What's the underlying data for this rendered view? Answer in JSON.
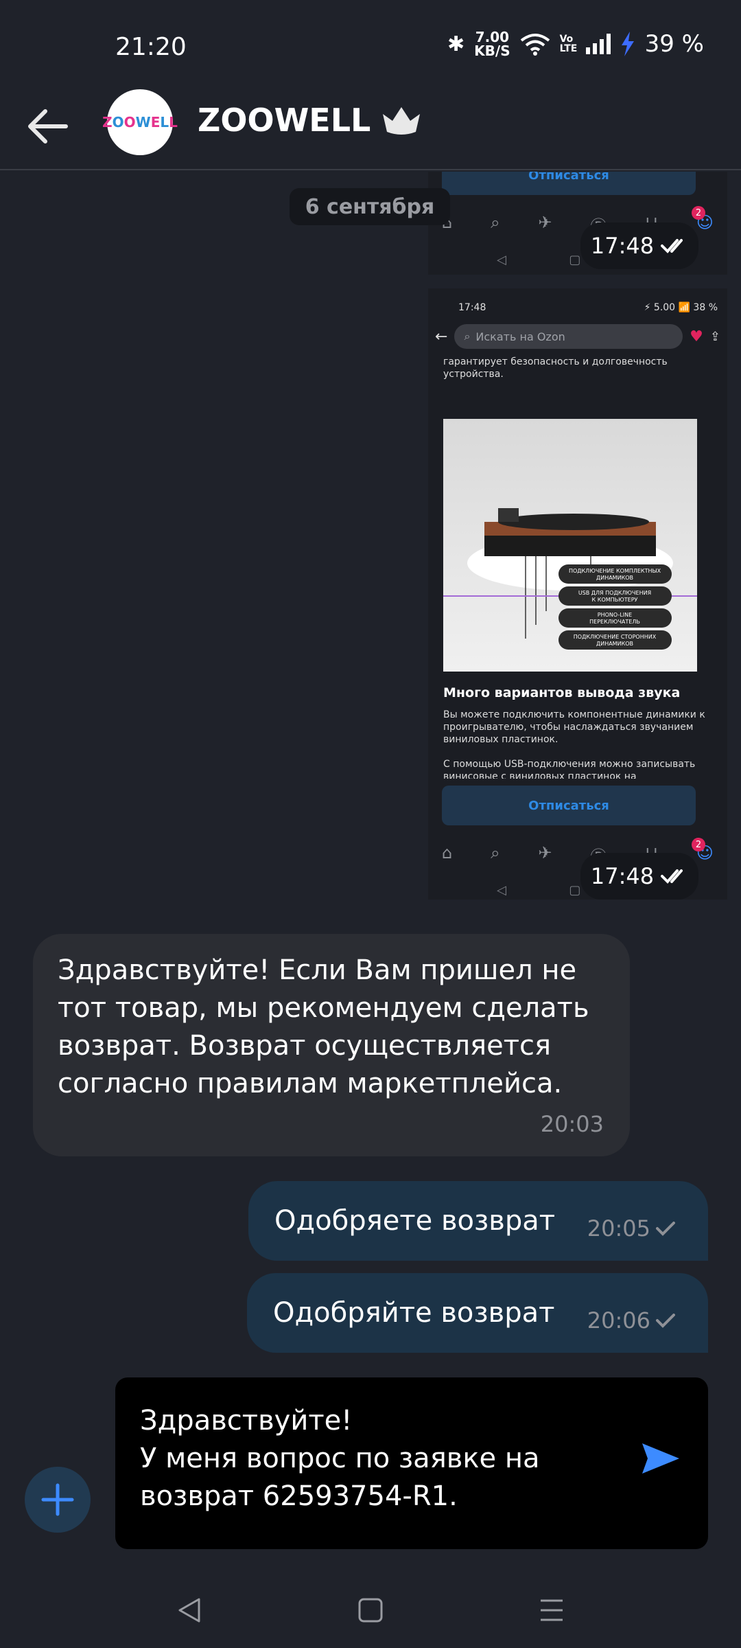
{
  "status_bar": {
    "time": "21:20",
    "net_speed_value": "7.00",
    "net_speed_unit": "KB/S",
    "battery": "39 %",
    "volte": "Vo LTE"
  },
  "header": {
    "title": "ZOOWELL",
    "avatar_letters": [
      "Z",
      "O",
      "O",
      "W",
      "E",
      "L",
      "L"
    ]
  },
  "chat": {
    "date_label": "6 сентября",
    "screenshot1": {
      "unsubscribe": "Отписаться",
      "time": "17:48"
    },
    "screenshot2": {
      "status_time": "17:48",
      "status_right": "⚡ 5.00 📶 38 %",
      "search_placeholder": "Искать на Ozon",
      "text_top": "гарантирует безопасность и долговечность устройства.",
      "callouts": [
        "ПОДКЛЮЧЕНИЕ КОМПЛЕКТНЫХ ДИНАМИКОВ",
        "USB ДЛЯ ПОДКЛЮЧЕНИЯ К КОМПЬЮТЕРУ",
        "PHONO-LINE ПЕРЕКЛЮЧАТЕЛЬ",
        "ПОДКЛЮЧЕНИЕ СТОРОННИХ ДИНАМИКОВ"
      ],
      "product_title": "Много вариантов вывода звука",
      "product_desc": "Вы можете подключить компонентные динамики к проигрывателю, чтобы наслаждаться звучанием виниловых пластинок.",
      "product_desc2": "С помощью USB-подключения можно записывать винисовые с виниловых пластинок на",
      "unsubscribe": "Отписаться",
      "badge": "2",
      "time": "17:48"
    },
    "incoming": {
      "text": "Здравствуйте! Если Вам пришел не тот товар, мы рекомендуем сделать возврат. Возврат осуществляется согласно правилам маркетплейса.",
      "time": "20:03"
    },
    "outgoing": [
      {
        "text": "Одобряете возврат",
        "time": "20:05"
      },
      {
        "text": "Одобряйте возврат",
        "time": "20:06"
      }
    ]
  },
  "composer": {
    "line1": "Здравствуйте!",
    "line2": "У меня вопрос по заявке на возврат 62593754-R1."
  },
  "icons": {
    "back": "back-arrow-icon",
    "plus": "plus-icon",
    "send": "send-icon",
    "check": "double-check-icon"
  },
  "colors": {
    "background": "#1f222a",
    "incoming_bubble": "#2b2d33",
    "outgoing_bubble": "#1c3347",
    "accent": "#3d8bff"
  }
}
